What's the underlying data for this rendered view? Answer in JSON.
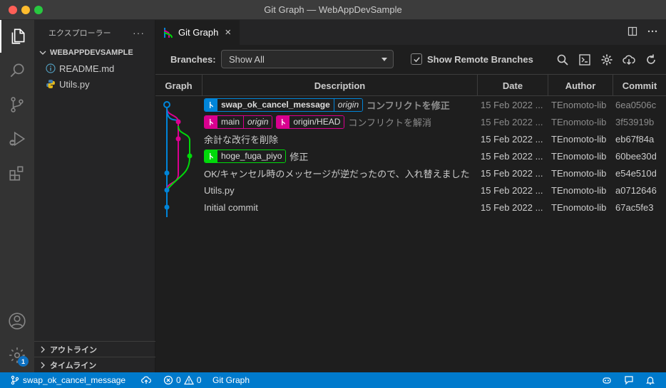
{
  "window": {
    "title": "Git Graph — WebAppDevSample"
  },
  "activity_bar": {
    "items": [
      "explorer-icon",
      "search-icon",
      "source-control-icon",
      "run-debug-icon",
      "extensions-icon"
    ],
    "bottom": [
      "account-icon",
      "settings-gear-icon"
    ],
    "settings_badge": "1"
  },
  "sidebar": {
    "header": "エクスプローラー",
    "more": "···",
    "project": "WEBAPPDEVSAMPLE",
    "files": [
      {
        "name": "README.md",
        "icon": "info-icon"
      },
      {
        "name": "Utils.py",
        "icon": "python-icon"
      }
    ],
    "outline": "アウトライン",
    "timeline": "タイムライン"
  },
  "tab": {
    "label": "Git Graph",
    "close": "×"
  },
  "controls": {
    "branches_label": "Branches:",
    "branches_value": "Show All",
    "show_remote_label": "Show Remote Branches",
    "show_remote_checked": true
  },
  "table": {
    "headers": {
      "graph": "Graph",
      "description": "Description",
      "date": "Date",
      "author": "Author",
      "commit": "Commit"
    },
    "rows": [
      {
        "refs": [
          {
            "name": "swap_ok_cancel_message",
            "remote": "origin",
            "color": "blue"
          }
        ],
        "message": "コンフリクトを修正",
        "date": "15 Feb 2022 ...",
        "author": "TEnomoto-lib",
        "commit": "6ea0506c"
      },
      {
        "refs": [
          {
            "name": "main",
            "remote": "origin",
            "color": "pink"
          },
          {
            "name": "origin/HEAD",
            "color": "pink"
          }
        ],
        "message": "コンフリクトを解消",
        "date": "15 Feb 2022 ...",
        "author": "TEnomoto-lib",
        "commit": "3f53919b"
      },
      {
        "refs": [],
        "message": "余計な改行を削除",
        "date": "15 Feb 2022 ...",
        "author": "TEnomoto-lib",
        "commit": "eb67f84a"
      },
      {
        "refs": [
          {
            "name": "hoge_fuga_piyo",
            "color": "green"
          }
        ],
        "message": "修正",
        "date": "15 Feb 2022 ...",
        "author": "TEnomoto-lib",
        "commit": "60bee30d"
      },
      {
        "refs": [],
        "message": "OK/キャンセル時のメッセージが逆だったので、入れ替えました",
        "date": "15 Feb 2022 ...",
        "author": "TEnomoto-lib",
        "commit": "e54e510d"
      },
      {
        "refs": [],
        "message": "Utils.py",
        "date": "15 Feb 2022 ...",
        "author": "TEnomoto-lib",
        "commit": "a0712646"
      },
      {
        "refs": [],
        "message": "Initial commit",
        "date": "15 Feb 2022 ...",
        "author": "TEnomoto-lib",
        "commit": "67ac5fe3"
      }
    ]
  },
  "colors": {
    "blue": "#0085d9",
    "pink": "#d9008f",
    "green": "#00d90a",
    "statusbar": "#007acc"
  },
  "statusbar": {
    "branch": "swap_ok_cancel_message",
    "errors": "0",
    "warnings": "0",
    "git_graph": "Git Graph"
  }
}
